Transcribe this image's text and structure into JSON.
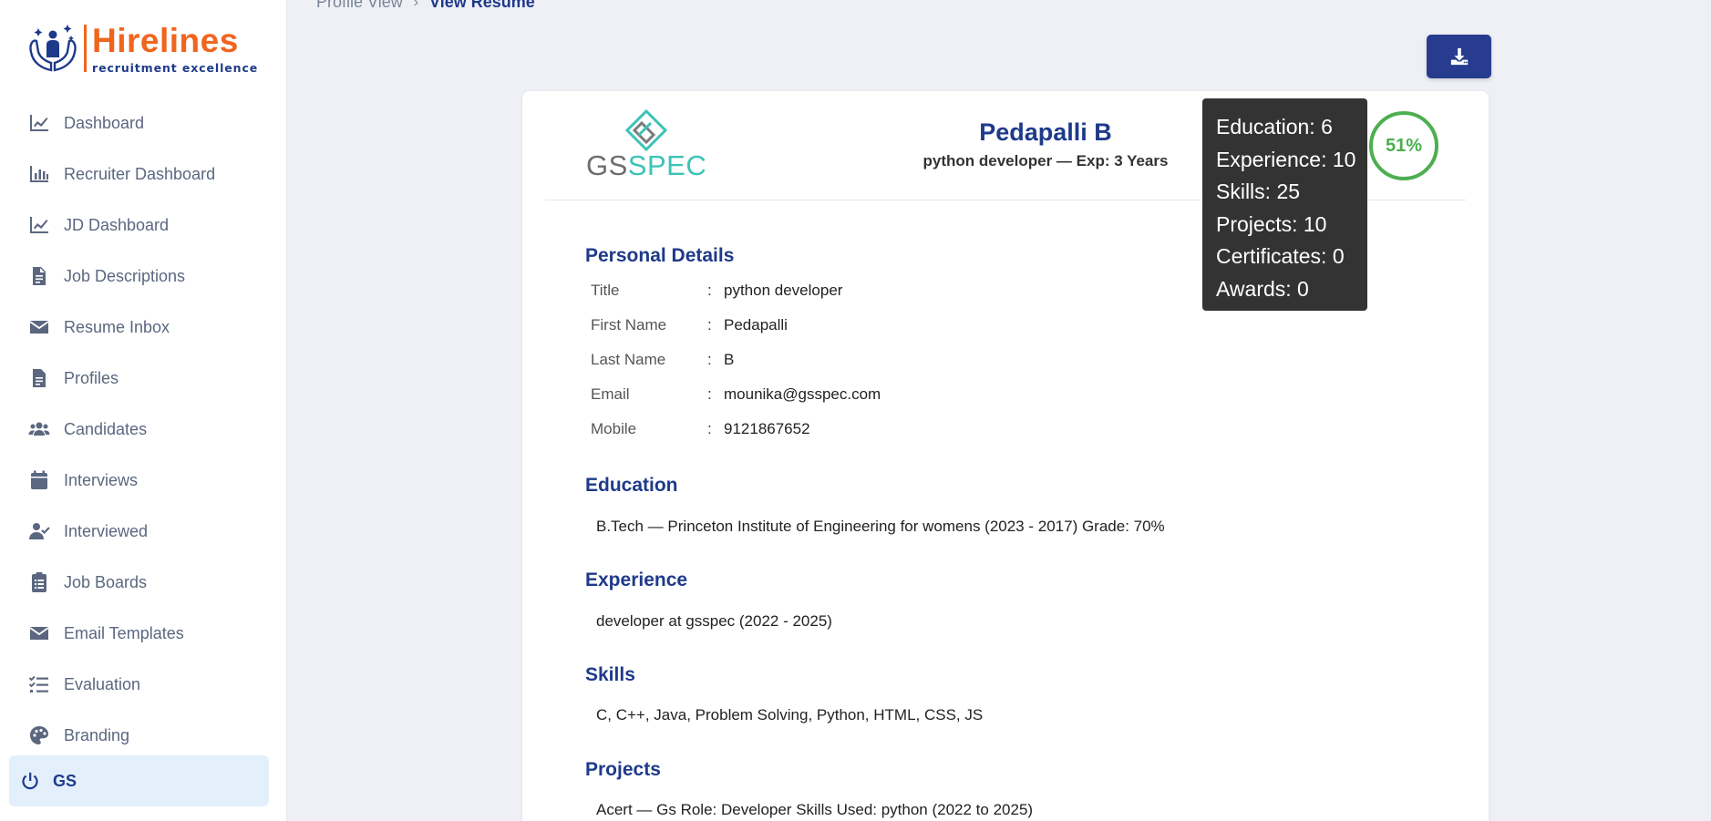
{
  "brand": {
    "name": "Hirelines",
    "tagline": "recruitment excellence",
    "accent": "#f0651d",
    "primary": "#1e3a8a"
  },
  "sidebar": {
    "items": [
      {
        "label": "Dashboard",
        "icon": "chart-line-icon"
      },
      {
        "label": "Recruiter Dashboard",
        "icon": "chart-bar-icon"
      },
      {
        "label": "JD Dashboard",
        "icon": "chart-line-icon"
      },
      {
        "label": "Job Descriptions",
        "icon": "document-icon"
      },
      {
        "label": "Resume Inbox",
        "icon": "envelope-icon"
      },
      {
        "label": "Profiles",
        "icon": "document-icon"
      },
      {
        "label": "Candidates",
        "icon": "users-icon"
      },
      {
        "label": "Interviews",
        "icon": "calendar-icon"
      },
      {
        "label": "Interviewed",
        "icon": "user-check-icon"
      },
      {
        "label": "Job Boards",
        "icon": "clipboard-list-icon"
      },
      {
        "label": "Email Templates",
        "icon": "envelope-icon"
      },
      {
        "label": "Evaluation",
        "icon": "list-check-icon"
      },
      {
        "label": "Branding",
        "icon": "palette-icon"
      }
    ],
    "user": {
      "label": "GS",
      "icon": "power-icon"
    }
  },
  "breadcrumb": {
    "parent": "Profile View",
    "current": "View Resume"
  },
  "resume": {
    "company": {
      "part1": "GS",
      "part2": "SPEC"
    },
    "name": "Pedapalli B",
    "subtitle": "python developer — Exp: 3 Years",
    "score": "51%",
    "sections": {
      "personal": "Personal Details",
      "education": "Education",
      "experience": "Experience",
      "skills": "Skills",
      "projects": "Projects"
    },
    "personal_details": [
      {
        "label": "Title",
        "value": "python developer"
      },
      {
        "label": "First Name",
        "value": "Pedapalli"
      },
      {
        "label": "Last Name",
        "value": "B"
      },
      {
        "label": "Email",
        "value": "mounika@gsspec.com"
      },
      {
        "label": "Mobile",
        "value": "9121867652"
      }
    ],
    "education": "B.Tech — Princeton Institute of Engineering for womens (2023 - 2017) Grade: 70%",
    "experience": "developer at gsspec (2022 - 2025)",
    "skills": "C, C++, Java, Problem Solving, Python, HTML, CSS, JS",
    "projects": "Acert — Gs Role: Developer Skills Used: python (2022 to 2025)"
  },
  "tooltip": {
    "lines": [
      "Education: 6",
      "Experience: 10",
      "Skills: 25",
      "Projects: 10",
      "Certificates: 0",
      "Awards: 0"
    ]
  }
}
